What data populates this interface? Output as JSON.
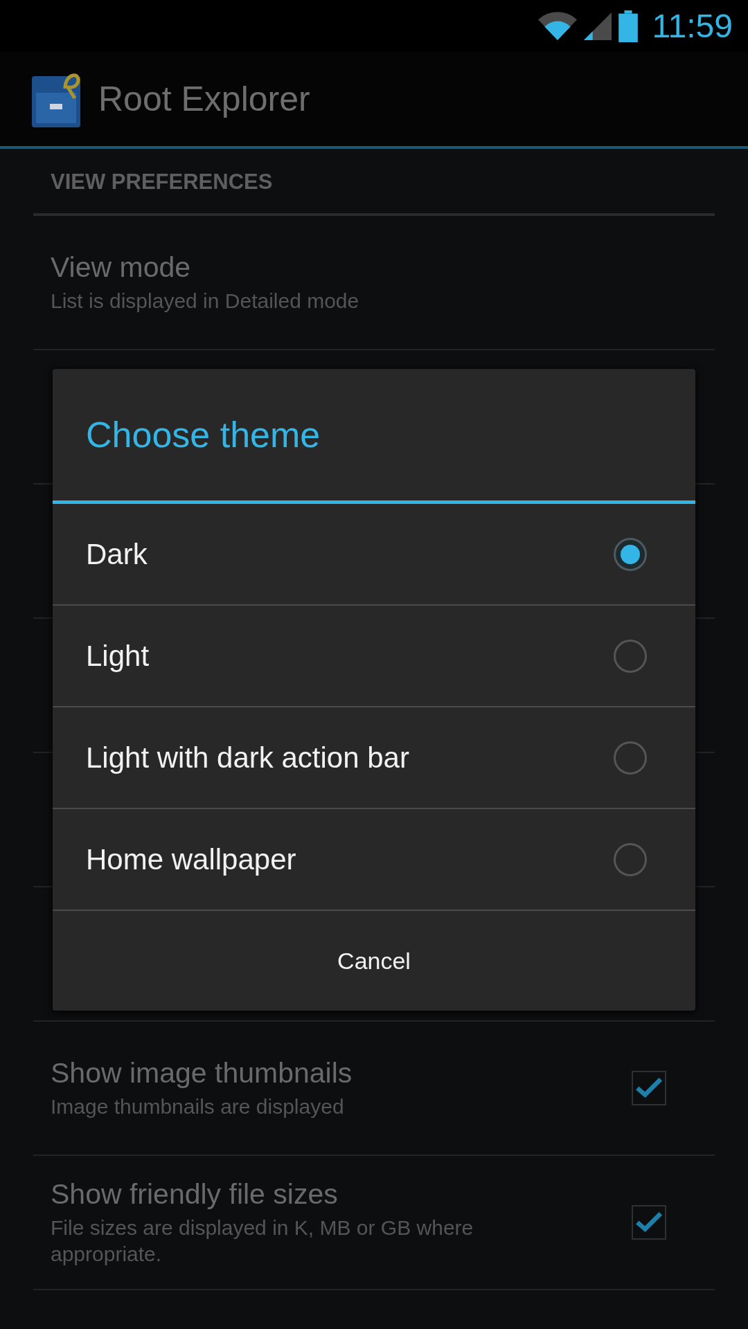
{
  "status_bar": {
    "time": "11:59"
  },
  "app_bar": {
    "title": "Root Explorer"
  },
  "section_header": "VIEW PREFERENCES",
  "preferences_top": [
    {
      "title": "View mode",
      "summary": "List is displayed in Detailed mode"
    }
  ],
  "preferences_bottom": [
    {
      "kind": "checkbox",
      "title": "Show image thumbnails",
      "summary": "Image thumbnails are displayed",
      "checked": true
    },
    {
      "kind": "checkbox",
      "title": "Show friendly file sizes",
      "summary": "File sizes are displayed in K, MB or GB where appropriate.",
      "checked": true
    }
  ],
  "dialog": {
    "title": "Choose theme",
    "options": [
      {
        "label": "Dark",
        "selected": true
      },
      {
        "label": "Light",
        "selected": false
      },
      {
        "label": "Light with dark action bar",
        "selected": false
      },
      {
        "label": "Home wallpaper",
        "selected": false
      }
    ],
    "cancel_button": "Cancel"
  }
}
